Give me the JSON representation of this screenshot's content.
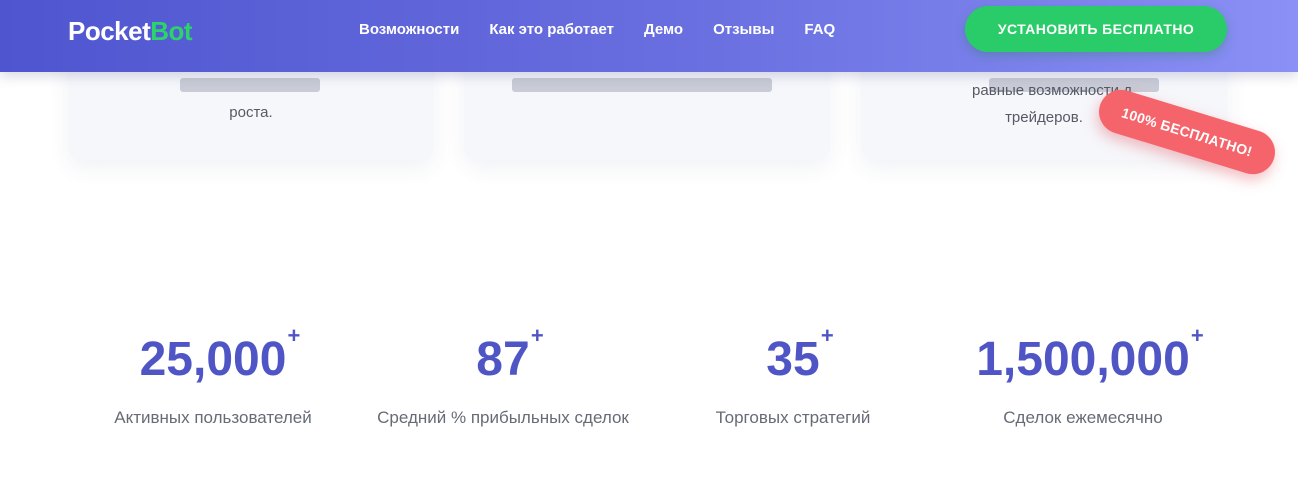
{
  "header": {
    "logo_part1": "Pocket",
    "logo_part2": "Bot",
    "nav": [
      {
        "label": "Возможности"
      },
      {
        "label": "Как это работает"
      },
      {
        "label": "Демо"
      },
      {
        "label": "Отзывы"
      },
      {
        "label": "FAQ"
      }
    ],
    "cta_label": "УСТАНОВИТЬ БЕСПЛАТНО"
  },
  "cards": [
    {
      "lines": [
        "роста."
      ]
    },
    {
      "lines": []
    },
    {
      "lines": [
        "равные возможности д",
        "трейдеров."
      ]
    }
  ],
  "badge": "100% БЕСПЛАТНО!",
  "stats": [
    {
      "value": "25,000",
      "suffix": "+",
      "label": "Активных пользователей"
    },
    {
      "value": "87",
      "suffix": "+",
      "label": "Средний % прибыльных сделок"
    },
    {
      "value": "35",
      "suffix": "+",
      "label": "Торговых стратегий"
    },
    {
      "value": "1,500,000",
      "suffix": "+",
      "label": "Сделок ежемесячно"
    }
  ],
  "colors": {
    "header_start": "#4f55cf",
    "header_end": "#8a90f5",
    "cta": "#29cc68",
    "logo_accent": "#2ad46a",
    "badge": "#f5646a",
    "stat_number": "#4f55c5"
  }
}
